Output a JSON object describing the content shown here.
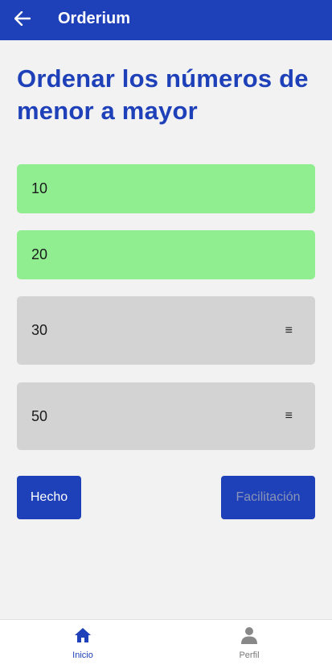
{
  "appbar": {
    "title": "Orderium",
    "back_icon": "arrow-left-icon"
  },
  "main": {
    "heading": "Ordenar los números de menor a mayor",
    "items": [
      {
        "label": "10",
        "state": "correct"
      },
      {
        "label": "20",
        "state": "correct"
      },
      {
        "label": "30",
        "state": "pending",
        "handle": "≡"
      },
      {
        "label": "50",
        "state": "pending",
        "handle": "≡"
      }
    ],
    "done_label": "Hecho",
    "help_label": "Facilitación"
  },
  "bottom_nav": {
    "home_label": "Inicio",
    "home_icon": "home-icon",
    "profile_label": "Perfil",
    "profile_icon": "person-icon"
  },
  "colors": {
    "primary": "#1e40b8",
    "correct": "#90ee90",
    "pending": "#d3d3d3",
    "background": "#f2f2f2"
  }
}
